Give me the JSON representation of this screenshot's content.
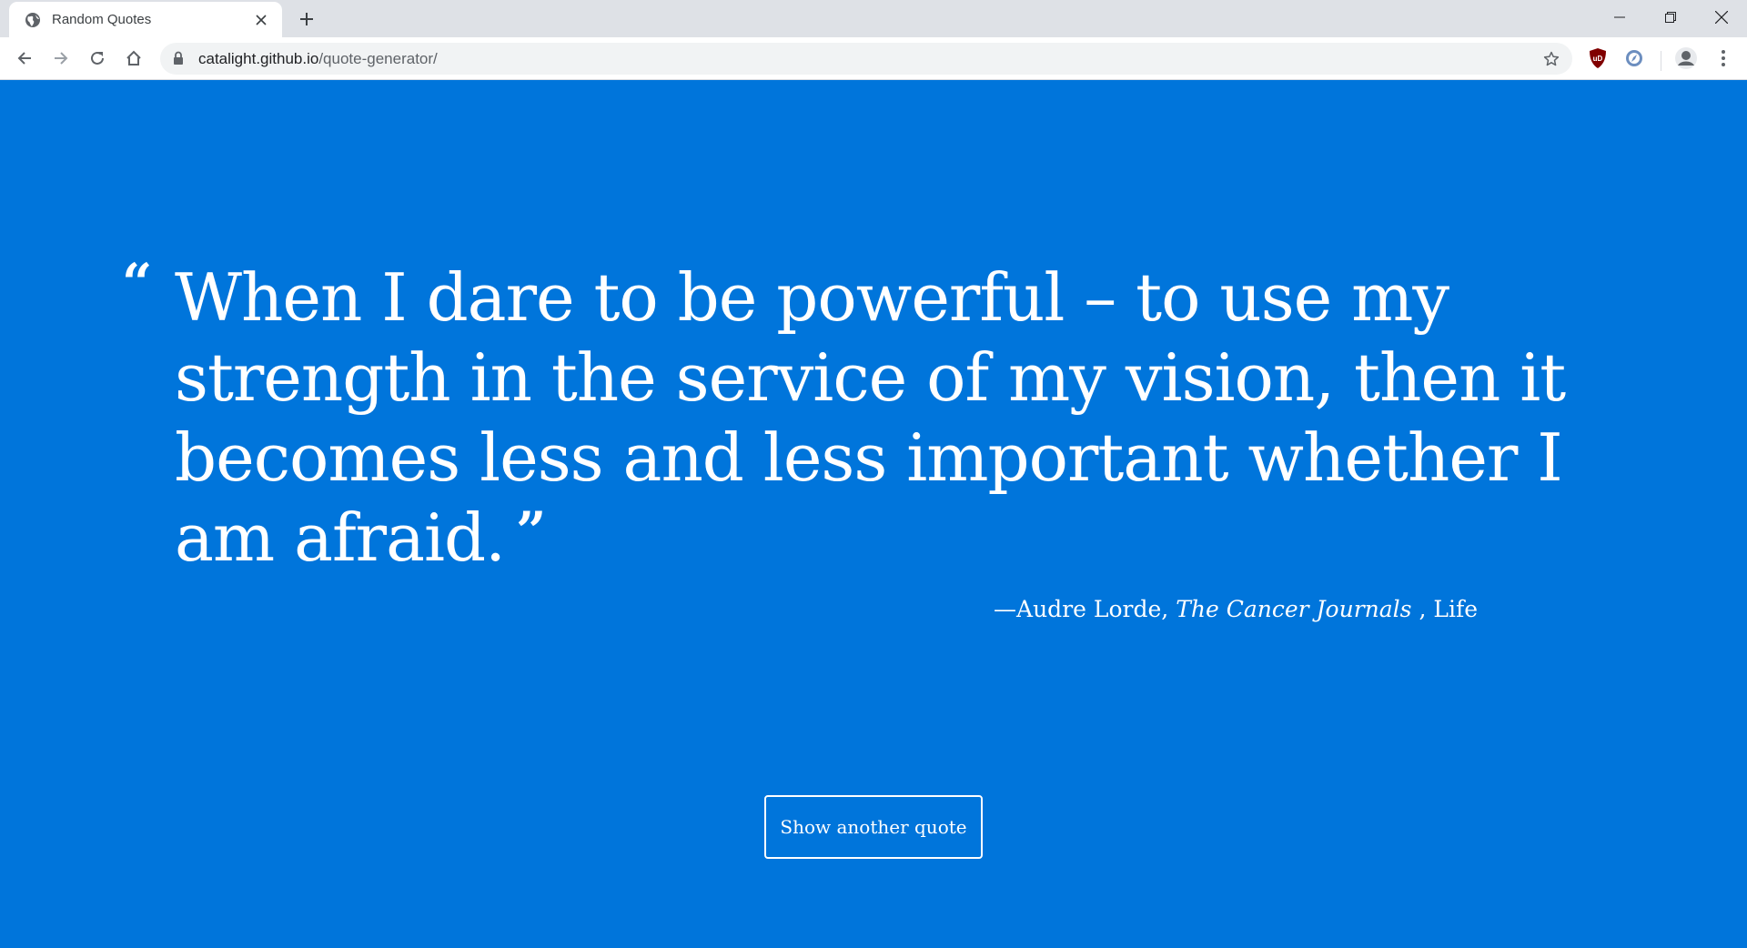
{
  "browser": {
    "tab_title": "Random Quotes",
    "url_host": "catalight.github.io",
    "url_path": "/quote-generator/",
    "extension_ublock_label": "uD"
  },
  "quote": {
    "text": "When I dare to be powerful – to use my strength in the service of my vision, then it becomes less and less important whether I am afraid.",
    "open_mark": "“",
    "close_mark": "”",
    "author_prefix": "—Audre Lorde, ",
    "work": "The Cancer Journals",
    "category_sep": " , ",
    "category": "Life"
  },
  "actions": {
    "show_another": "Show another quote"
  },
  "colors": {
    "page_background": "#0075DB",
    "text": "#FFFFFF",
    "chrome_bar": "#DEE1E6"
  }
}
